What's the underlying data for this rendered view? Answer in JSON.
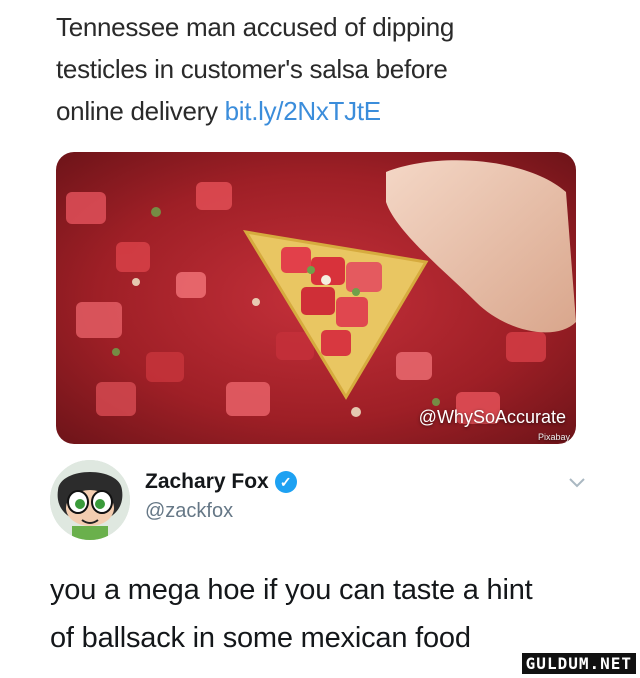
{
  "headline": {
    "line1": "Tennessee man accused of dipping",
    "line2": "testicles in customer's salsa before",
    "line3_text": "online delivery ",
    "link": "bit.ly/2NxTJtE"
  },
  "photo": {
    "watermark": "@WhySoAccurate",
    "credit": "Pixabay",
    "icon": "salsa-chip-photo"
  },
  "tweet": {
    "author_name": "Zachary Fox",
    "author_handle": "@zackfox",
    "verified": true,
    "text_line1": "you a mega hoe if you can taste a hint",
    "text_line2": "of ballsack in some mexican food"
  },
  "site_logo": "GULDUM.NET",
  "colors": {
    "link": "#3b8ddb",
    "verified": "#1da1f2",
    "handle": "#657786"
  }
}
